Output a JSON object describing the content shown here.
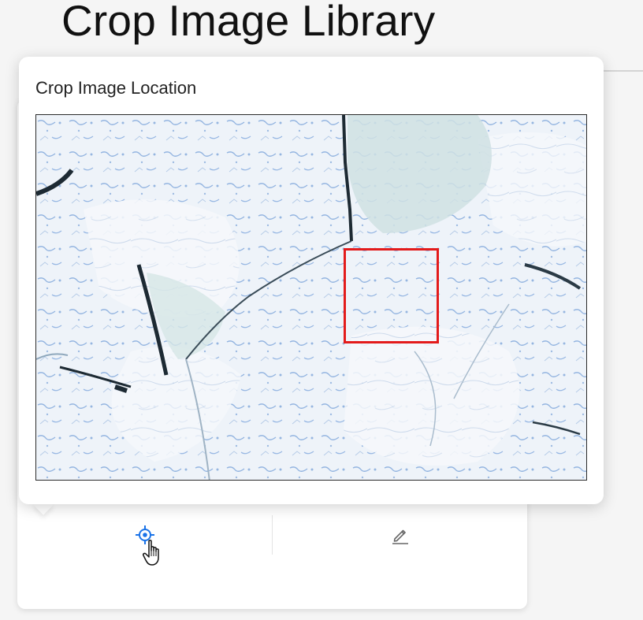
{
  "page": {
    "title": "Crop Image Library"
  },
  "popover": {
    "title": "Crop Image Location",
    "image_alt": "Satellite image of sea ice",
    "crop_box_color": "#e31b1b"
  },
  "card": {
    "actions": [
      {
        "name": "locate",
        "icon": "crosshair-icon",
        "color": "#1a73e8"
      },
      {
        "name": "edit",
        "icon": "pencil-icon",
        "color": "#666666"
      }
    ]
  },
  "colors": {
    "accent": "#1a73e8",
    "ice": "#f4f7fb",
    "water": "#3b74c8",
    "crack": "#1d2a33"
  }
}
